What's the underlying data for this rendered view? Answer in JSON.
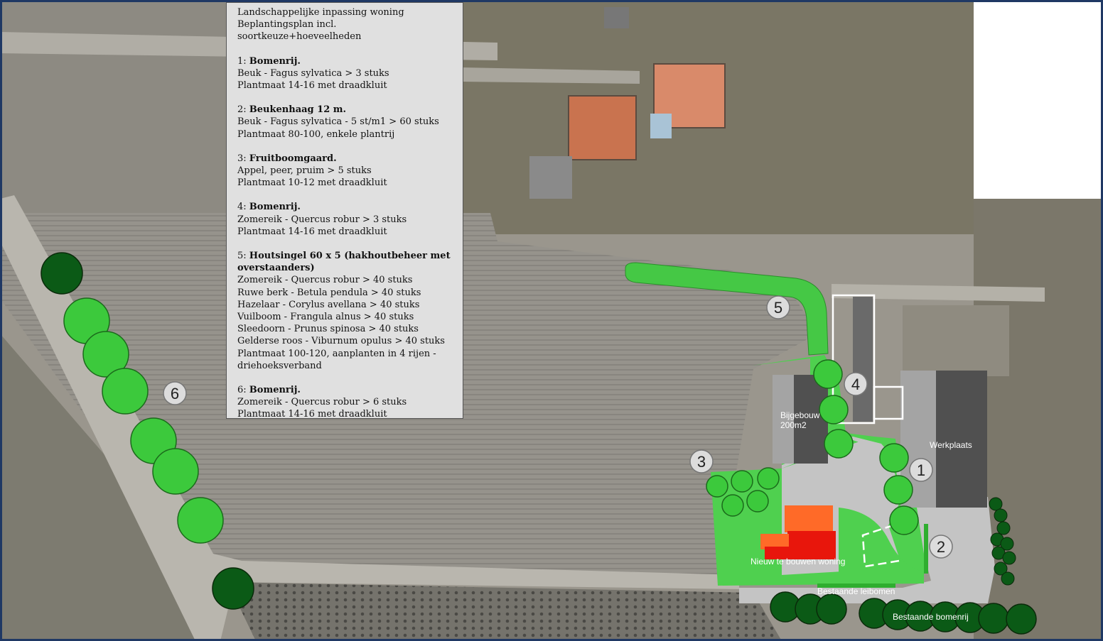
{
  "legend": {
    "heading_1": "Landschappelijke inpassing woning",
    "heading_2": "Beplantingsplan incl. soortkeuze+hoeveelheden",
    "items": [
      {
        "num": "1:",
        "title": "Bomenrij.",
        "lines": [
          "Beuk - Fagus sylvatica > 3 stuks",
          "Plantmaat 14-16 met draadkluit"
        ]
      },
      {
        "num": "2:",
        "title": "Beukenhaag 12 m.",
        "lines": [
          "Beuk - Fagus sylvatica - 5 st/m1 > 60 stuks",
          "Plantmaat 80-100, enkele plantrij"
        ]
      },
      {
        "num": "3:",
        "title": "Fruitboomgaard.",
        "lines": [
          "Appel, peer, pruim > 5 stuks",
          "Plantmaat 10-12 met draadkluit"
        ]
      },
      {
        "num": "4:",
        "title": "Bomenrij.",
        "lines": [
          "Zomereik - Quercus robur > 3 stuks",
          "Plantmaat 14-16 met draadkluit"
        ]
      },
      {
        "num": "5:",
        "title": "Houtsingel  60 x 5 (hakhoutbeheer met overstaanders)",
        "lines": [
          "Zomereik - Quercus robur > 40 stuks",
          "Ruwe berk - Betula pendula > 40 stuks",
          "Hazelaar - Corylus avellana > 40 stuks",
          "Vuilboom - Frangula alnus > 40 stuks",
          "Sleedoorn - Prunus spinosa > 40 stuks",
          "Gelderse roos - Viburnum opulus > 40 stuks",
          "Plantmaat 100-120, aanplanten in 4 rijen - driehoeksverband"
        ]
      },
      {
        "num": "6:",
        "title": "Bomenrij.",
        "lines": [
          "Zomereik - Quercus robur > 6 stuks",
          "Plantmaat 14-16 met draadkluit"
        ]
      }
    ]
  },
  "map_labels": {
    "bijgebouw_1": "Bijgebouw",
    "bijgebouw_2": "200m2",
    "werkplaats": "Werkplaats",
    "woning": "Nieuw te bouwen woning",
    "leibomen": "Bestaande leibomen",
    "bomenrij": "Bestaande bomenrij"
  },
  "markers": [
    "1",
    "2",
    "3",
    "4",
    "5",
    "6"
  ],
  "colors": {
    "frame": "#1f3864",
    "new_tree": "#3cc93c",
    "existing_tree": "#0b5a16",
    "lawn": "#4fd04f",
    "paving": "#c4c4c4",
    "building_dark": "#505050",
    "building_light": "#a4a4a4",
    "house_red": "#e8160c",
    "house_orange": "#ff6a28"
  }
}
